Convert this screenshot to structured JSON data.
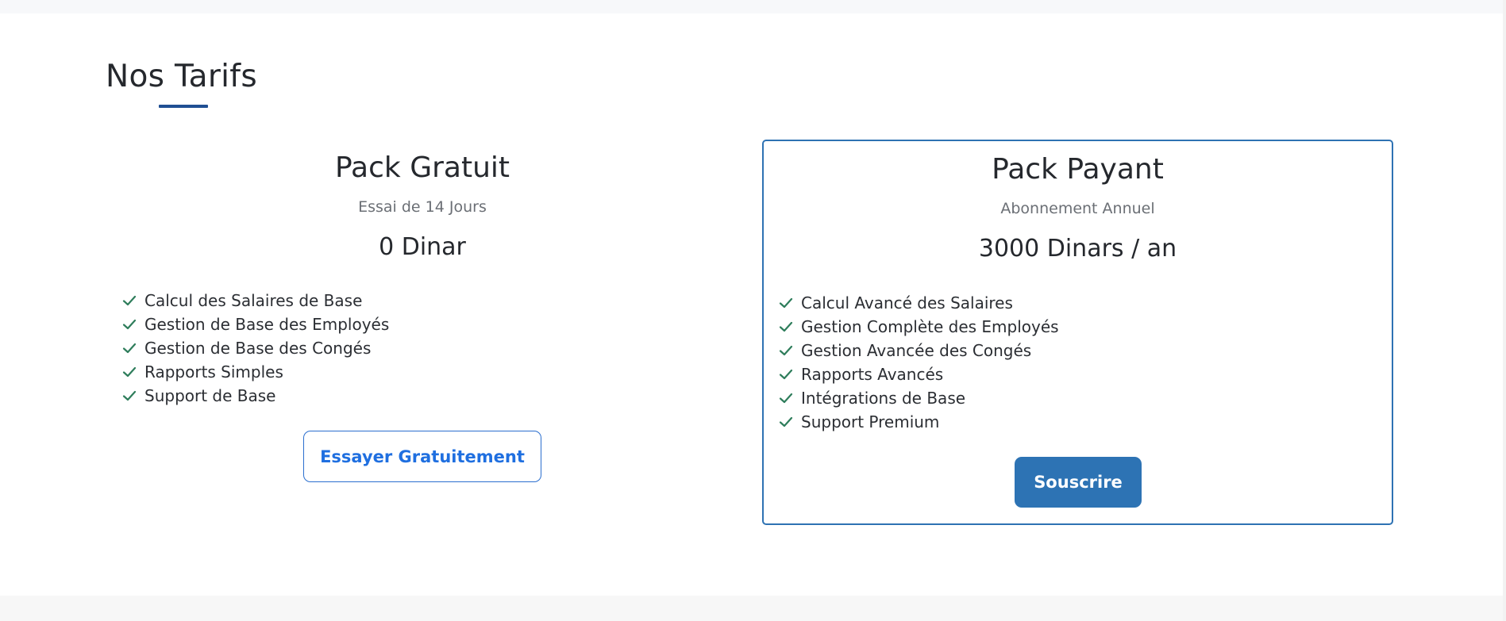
{
  "section": {
    "title": "Nos Tarifs"
  },
  "colors": {
    "accent": "#1f4f93",
    "primary_button": "#2d73b4",
    "outline_button_text": "#1f6fe0",
    "check": "#2e7d5b"
  },
  "plans": [
    {
      "name": "Pack Gratuit",
      "subtitle": "Essai de 14 Jours",
      "price": "0 Dinar",
      "features": [
        "Calcul des Salaires de Base",
        "Gestion de Base des Employés",
        "Gestion de Base des Congés",
        "Rapports Simples",
        "Support de Base"
      ],
      "button_label": "Essayer Gratuitement",
      "icon": "check-icon"
    },
    {
      "name": "Pack Payant",
      "subtitle": "Abonnement Annuel",
      "price": "3000 Dinars / an",
      "features": [
        "Calcul Avancé des Salaires",
        "Gestion Complète des Employés",
        "Gestion Avancée des Congés",
        "Rapports Avancés",
        "Intégrations de Base",
        "Support Premium"
      ],
      "button_label": "Souscrire",
      "icon": "check-icon"
    }
  ]
}
